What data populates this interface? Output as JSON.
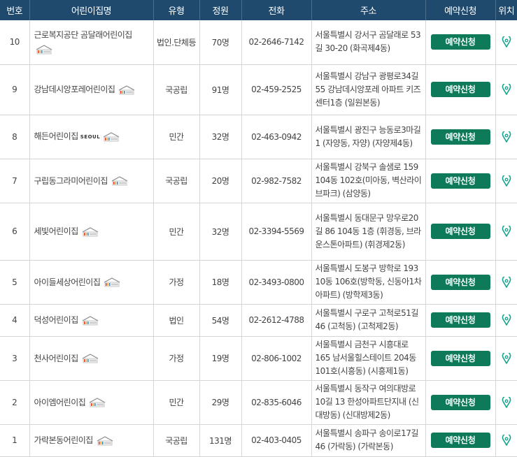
{
  "columns": {
    "no": "번호",
    "name": "어린이집명",
    "type": "유형",
    "capacity": "정원",
    "phone": "전화",
    "address": "주소",
    "reserve": "예약신청",
    "location": "위치"
  },
  "reserve_label": "예약신청",
  "seoul_logo_text": "SEOUL",
  "colors": {
    "header_bg": "#1f4a6d",
    "button_bg": "#0f7a5a",
    "pin_color": "#14a38b",
    "border": "#d6d6d6"
  },
  "icons": {
    "certification_badge": "kcac-house-badge",
    "location": "map-pin-icon"
  },
  "rows": [
    {
      "no": "10",
      "name": "근로복지공단 곰달래어린이집",
      "type": "법인.단체등",
      "capacity": "70명",
      "phone": "02-2646-7142",
      "address": "서울특별시 강서구 곰달래로 53길 30-20 (화곡제4동)",
      "seoul_logo": false
    },
    {
      "no": "9",
      "name": "강남데시앙포레어린이집",
      "type": "국공립",
      "capacity": "91명",
      "phone": "02-459-2525",
      "address": "서울특별시 강남구 광평로34길 55 강남데시앙포레 아파트 키즈센터1층 (일원본동)",
      "seoul_logo": false
    },
    {
      "no": "8",
      "name": "해든어린이집",
      "type": "민간",
      "capacity": "32명",
      "phone": "02-463-0942",
      "address": "서울특별시 광진구 능동로3마길 1 (자양동, 자양) (자양제4동)",
      "seoul_logo": true
    },
    {
      "no": "7",
      "name": "구립동그라미어린이집",
      "type": "국공립",
      "capacity": "20명",
      "phone": "02-982-7582",
      "address": "서울특별시 강북구 솔샘로 159 104동 102호(미아동, 벽산라이브파크) (삼양동)",
      "seoul_logo": false
    },
    {
      "no": "6",
      "name": "세빛어린이집",
      "type": "민간",
      "capacity": "32명",
      "phone": "02-3394-5569",
      "address": "서울특별시 동대문구 망우로20길 86 104동 1층 (휘경동, 브라운스톤아파트) (휘경제2동)",
      "seoul_logo": false
    },
    {
      "no": "5",
      "name": "아이들세상어린이집",
      "type": "가정",
      "capacity": "18명",
      "phone": "02-3493-0800",
      "address": "서울특별시 도봉구 방학로 193 10동 106호(방학동, 신동아1차아파트) (방학제3동)",
      "seoul_logo": false
    },
    {
      "no": "4",
      "name": "덕성어린이집",
      "type": "법인",
      "capacity": "54명",
      "phone": "02-2612-4788",
      "address": "서울특별시 구로구 고척로51길 46 (고척동) (고척제2동)",
      "seoul_logo": false
    },
    {
      "no": "3",
      "name": "천사어린이집",
      "type": "가정",
      "capacity": "19명",
      "phone": "02-806-1002",
      "address": "서울특별시 금천구 시흥대로 165 남서울힐스테이트 204동 101호(시흥동) (시흥제1동)",
      "seoul_logo": false
    },
    {
      "no": "2",
      "name": "아이엠어린이집",
      "type": "민간",
      "capacity": "29명",
      "phone": "02-835-6046",
      "address": "서울특별시 동작구 여의대방로10길 13 한성아파트단지내 (신대방동) (신대방제2동)",
      "seoul_logo": false
    },
    {
      "no": "1",
      "name": "가락본동어린이집",
      "type": "국공립",
      "capacity": "131명",
      "phone": "02-403-0405",
      "address": "서울특별시 송파구 송이로17길 46 (가락동) (가락본동)",
      "seoul_logo": false
    }
  ]
}
